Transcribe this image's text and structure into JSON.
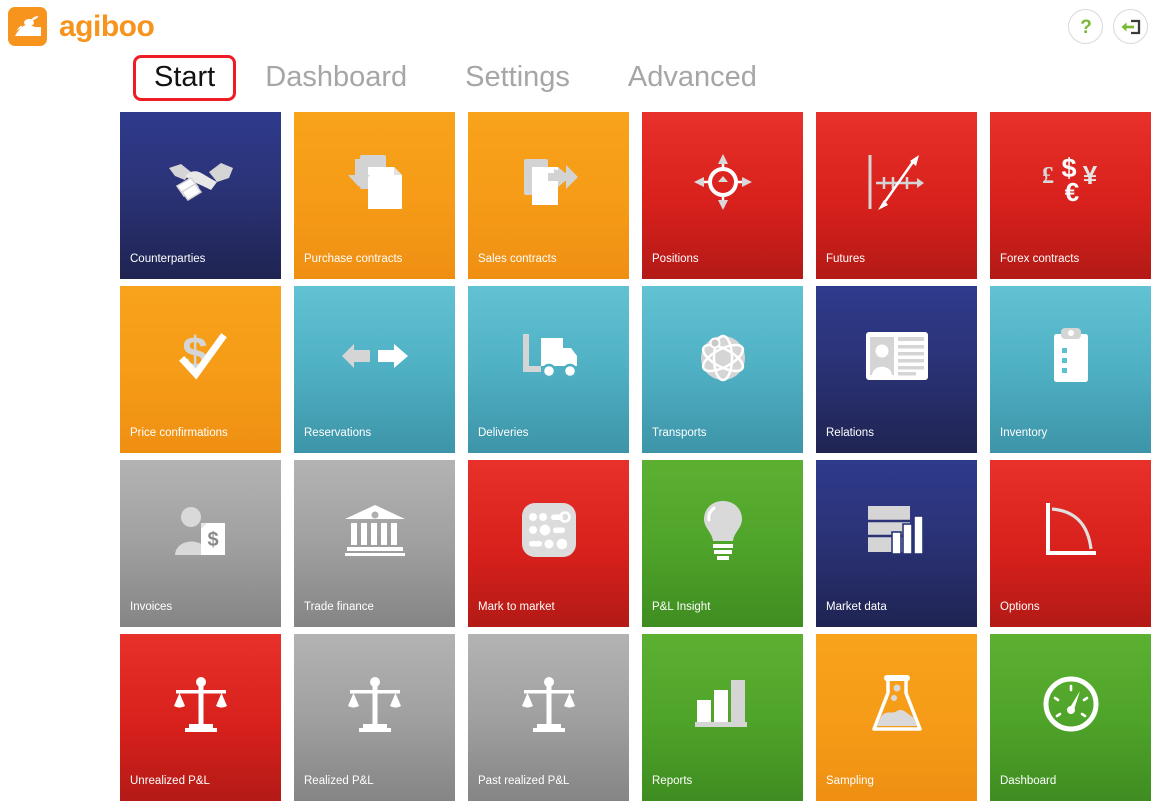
{
  "header": {
    "brand_name": "agiboo",
    "logo_icon": "agiboo-hare-logo-icon",
    "help_button": {
      "icon": "question-mark-icon",
      "label": "?"
    },
    "logout_button": {
      "icon": "logout-arrow-icon",
      "label": ""
    }
  },
  "nav": {
    "tabs": [
      {
        "label": "Start",
        "active": true
      },
      {
        "label": "Dashboard",
        "active": false
      },
      {
        "label": "Settings",
        "active": false
      },
      {
        "label": "Advanced",
        "active": false
      }
    ],
    "active_highlight_color": "#ee1c24"
  },
  "colors": {
    "brand_orange": "#f7941e",
    "tile_navy": "#2b3377",
    "tile_orange": "#f69c18",
    "tile_red": "#d8201c",
    "tile_teal": "#4fb0c4",
    "tile_gray": "#a0a0a0",
    "tile_green": "#4fa42a",
    "accent_green": "#78b833"
  },
  "tiles": [
    {
      "label": "Counterparties",
      "color": "navy",
      "icon": "handshake-icon"
    },
    {
      "label": "Purchase contracts",
      "color": "orange",
      "icon": "document-incoming-arrow-icon"
    },
    {
      "label": "Sales contracts",
      "color": "orange",
      "icon": "document-outgoing-arrow-icon"
    },
    {
      "label": "Positions",
      "color": "red",
      "icon": "compass-crosshair-icon"
    },
    {
      "label": "Futures",
      "color": "red",
      "icon": "trend-axis-arrow-icon"
    },
    {
      "label": "Forex contracts",
      "color": "red",
      "icon": "currency-symbols-icon"
    },
    {
      "label": "Price confirmations",
      "color": "orange",
      "icon": "dollar-checkmark-icon"
    },
    {
      "label": "Reservations",
      "color": "teal",
      "icon": "left-right-arrows-icon"
    },
    {
      "label": "Deliveries",
      "color": "teal",
      "icon": "delivery-truck-icon"
    },
    {
      "label": "Transports",
      "color": "teal",
      "icon": "globe-orbit-icon"
    },
    {
      "label": "Relations",
      "color": "navy",
      "icon": "contact-card-icon"
    },
    {
      "label": "Inventory",
      "color": "teal",
      "icon": "clipboard-icon"
    },
    {
      "label": "Invoices",
      "color": "gray",
      "icon": "person-invoice-dollar-icon"
    },
    {
      "label": "Trade finance",
      "color": "gray",
      "icon": "bank-building-icon"
    },
    {
      "label": "Mark to market",
      "color": "red",
      "icon": "market-board-icon"
    },
    {
      "label": "P&L Insight",
      "color": "green",
      "icon": "lightbulb-icon"
    },
    {
      "label": "Market data",
      "color": "navy",
      "icon": "table-bar-chart-icon"
    },
    {
      "label": "Options",
      "color": "red",
      "icon": "curve-axes-icon"
    },
    {
      "label": "Unrealized P&L",
      "color": "red",
      "icon": "balance-scale-icon"
    },
    {
      "label": "Realized P&L",
      "color": "gray",
      "icon": "balance-scale-icon"
    },
    {
      "label": "Past realized P&L",
      "color": "gray",
      "icon": "balance-scale-icon"
    },
    {
      "label": "Reports",
      "color": "green",
      "icon": "bar-chart-icon"
    },
    {
      "label": "Sampling",
      "color": "orange",
      "icon": "flask-icon"
    },
    {
      "label": "Dashboard",
      "color": "green",
      "icon": "gauge-icon"
    }
  ]
}
